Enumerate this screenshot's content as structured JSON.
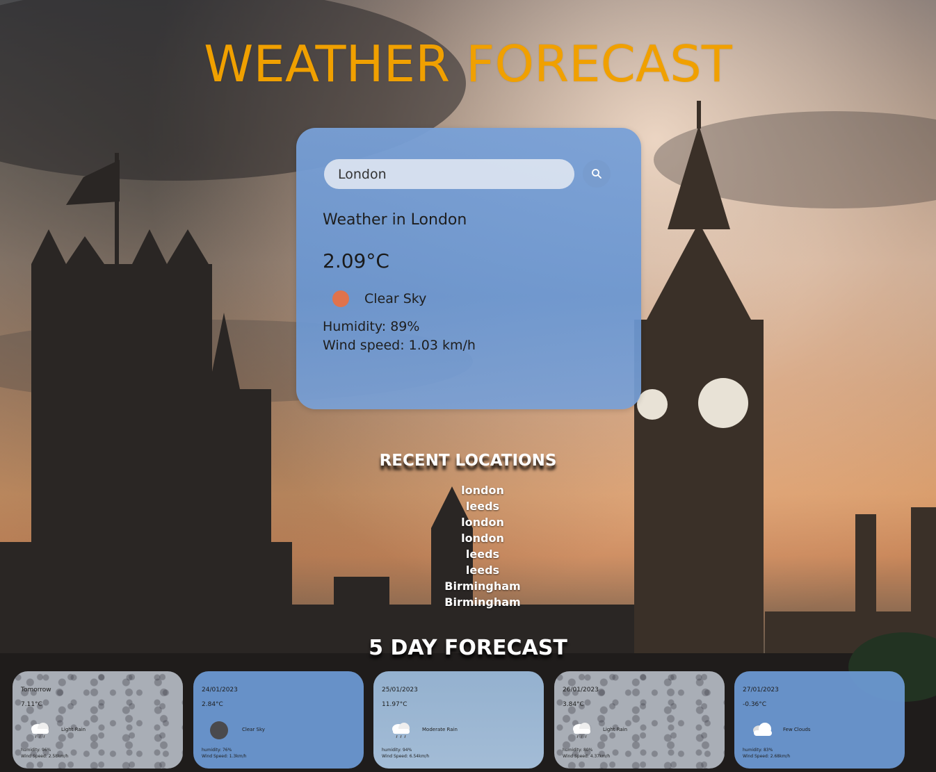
{
  "page": {
    "title": "WEATHER FORECAST"
  },
  "search": {
    "value": "London",
    "placeholder": ""
  },
  "current": {
    "heading": "Weather in London",
    "temperature": "2.09°C",
    "condition": "Clear Sky",
    "condition_icon": "sun-icon",
    "humidity": "Humidity: 89%",
    "wind": "Wind speed: 1.03 km/h"
  },
  "recent": {
    "title": "RECENT LOCATIONS",
    "items": [
      "london",
      "leeds",
      "london",
      "london",
      "leeds",
      "leeds",
      "Birmingham",
      "Birmingham"
    ]
  },
  "forecast": {
    "title": "5 DAY FORECAST",
    "days": [
      {
        "date": "Tomorrow",
        "temp": "7.11°C",
        "desc": "Light Rain",
        "icon": "cloud-rain-icon",
        "humidity": "humidity: 96%",
        "wind": "Wind Speed: 2.58km/h",
        "style": "rain"
      },
      {
        "date": "24/01/2023",
        "temp": "2.84°C",
        "desc": "Clear Sky",
        "icon": "moon-icon",
        "humidity": "humidity: 76%",
        "wind": "Wind Speed: 1.3km/h",
        "style": "blue"
      },
      {
        "date": "25/01/2023",
        "temp": "11.97°C",
        "desc": "Moderate Rain",
        "icon": "cloud-rain-icon",
        "humidity": "humidity: 94%",
        "wind": "Wind Speed: 6.54km/h",
        "style": "frost"
      },
      {
        "date": "26/01/2023",
        "temp": "3.84°C",
        "desc": "Light Rain",
        "icon": "cloud-rain-icon",
        "humidity": "humidity: 80%",
        "wind": "Wind Speed: 4.37km/h",
        "style": "rain"
      },
      {
        "date": "27/01/2023",
        "temp": "-0.36°C",
        "desc": "Few Clouds",
        "icon": "cloud-icon",
        "humidity": "humidity: 83%",
        "wind": "Wind Speed: 2.68km/h",
        "style": "blue"
      }
    ]
  },
  "colors": {
    "title": "#f0a000",
    "card": "#6e9bd7",
    "sun": "#e0734c"
  }
}
